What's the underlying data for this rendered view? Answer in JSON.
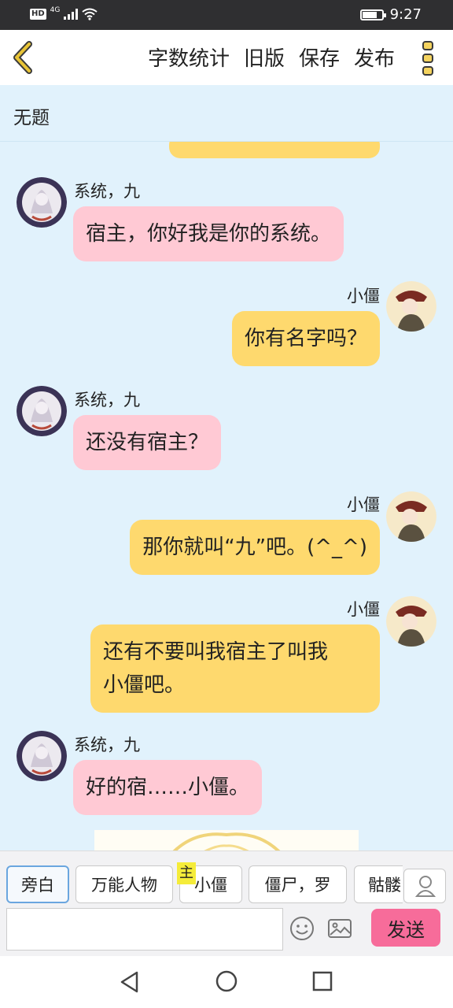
{
  "status_bar": {
    "network": "4G",
    "hd": "HD",
    "time": "9:27",
    "battery_level": 0.8
  },
  "toolbar": {
    "word_count": "字数统计",
    "old_version": "旧版",
    "save": "保存",
    "publish": "发布"
  },
  "story": {
    "title": "无题"
  },
  "messages": [
    {
      "side": "left",
      "sender": "系统，九",
      "text": "宿主，你好我是你的系统。"
    },
    {
      "side": "right",
      "sender": "小僵",
      "text": "你有名字吗？"
    },
    {
      "side": "left",
      "sender": "系统，九",
      "text": "还没有宿主？"
    },
    {
      "side": "right",
      "sender": "小僵",
      "text": "那你就叫“九”吧。(^_^)"
    },
    {
      "side": "right",
      "sender": "小僵",
      "text_line1": "还有不要叫我宿主了叫我",
      "text_line2": "小僵吧。"
    },
    {
      "side": "left",
      "sender": "系统，九",
      "text": "好的宿……小僵。"
    }
  ],
  "roles": [
    {
      "label": "旁白",
      "active": true
    },
    {
      "label": "万能人物",
      "active": false
    },
    {
      "label": "小僵",
      "active": false,
      "tag": "主"
    },
    {
      "label": "僵尸，罗",
      "active": false
    },
    {
      "label": "骷髅",
      "active": false
    }
  ],
  "composer": {
    "input_value": "",
    "placeholder": "",
    "send_label": "发送"
  },
  "colors": {
    "chat_bg": "#e1f2fc",
    "bubble_left": "#ffc9d4",
    "bubble_right": "#fed96e",
    "send_button": "#f76c9a",
    "accent": "#e8c437"
  },
  "icons": [
    "back-chevron-icon",
    "more-dots-icon",
    "user-icon",
    "emoji-icon",
    "image-icon",
    "nav-back-icon",
    "nav-home-icon",
    "nav-recent-icon"
  ]
}
